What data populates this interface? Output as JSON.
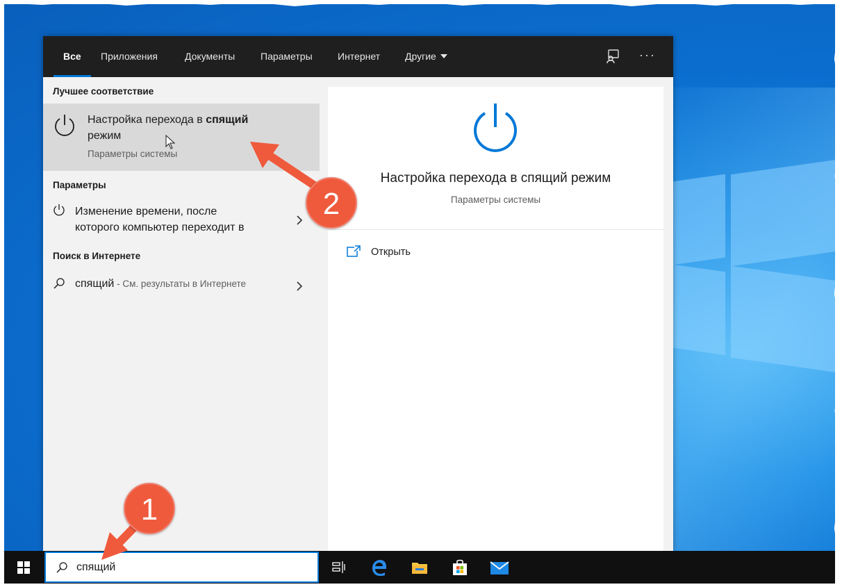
{
  "tabs": [
    {
      "label": "Все",
      "active": true
    },
    {
      "label": "Приложения"
    },
    {
      "label": "Документы"
    },
    {
      "label": "Параметры"
    },
    {
      "label": "Интернет"
    },
    {
      "label": "Другие"
    }
  ],
  "results": {
    "best_match_header": "Лучшее соответствие",
    "best_match": {
      "title_before": "Настройка перехода в ",
      "title_bold": "спящий",
      "title_after": " режим",
      "subtitle": "Параметры системы"
    },
    "settings_header": "Параметры",
    "settings_item": {
      "line1": "Изменение времени, после",
      "line2": "которого компьютер переходит в"
    },
    "web_header": "Поиск в Интернете",
    "web_item": {
      "query": "спящий",
      "separator": " - ",
      "hint": "См. результаты в Интернете"
    }
  },
  "preview": {
    "title": "Настройка перехода в спящий режим",
    "subtitle": "Параметры системы",
    "open_label": "Открыть"
  },
  "search": {
    "value": "спящий"
  },
  "annotations": {
    "badge1": "1",
    "badge2": "2"
  },
  "colors": {
    "accent": "#0078d7",
    "callout": "#ef5a3c",
    "tabbar": "#1f1f1f",
    "taskbar": "#101010"
  }
}
